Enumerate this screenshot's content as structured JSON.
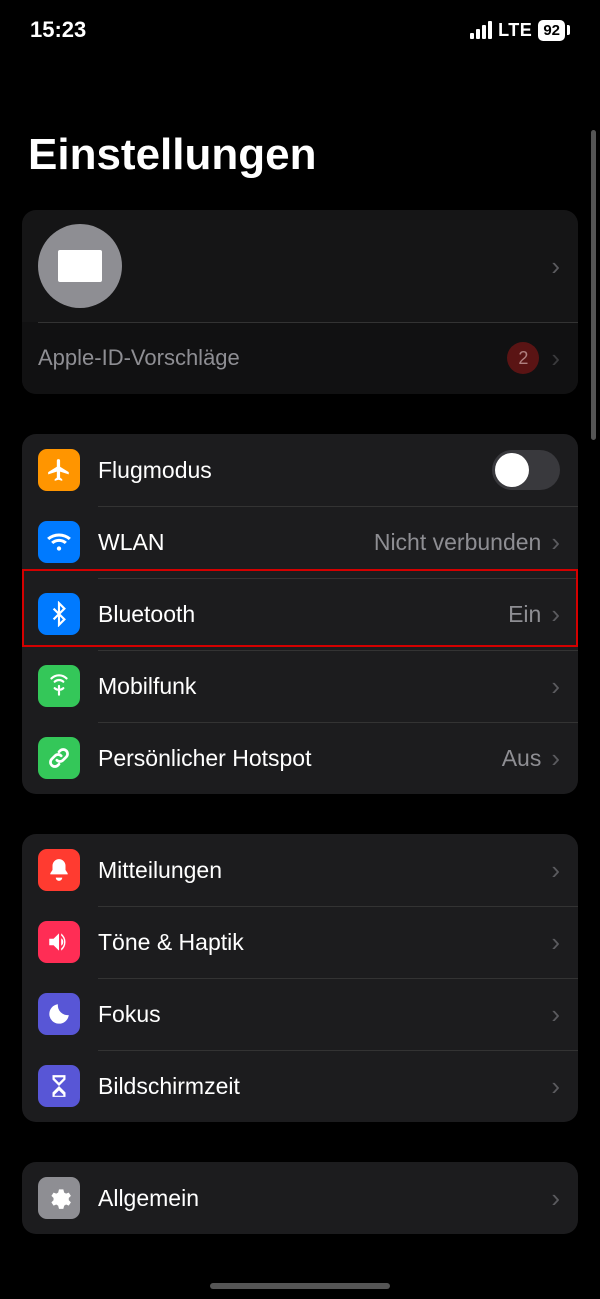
{
  "status_bar": {
    "time": "15:23",
    "network": "LTE",
    "battery": "92"
  },
  "title": "Einstellungen",
  "apple_id": {
    "suggestions_label": "Apple-ID-Vorschläge",
    "badge": "2"
  },
  "connectivity": {
    "airplane": "Flugmodus",
    "wlan": {
      "label": "WLAN",
      "value": "Nicht verbunden"
    },
    "bluetooth": {
      "label": "Bluetooth",
      "value": "Ein"
    },
    "cellular": "Mobilfunk",
    "hotspot": {
      "label": "Persönlicher Hotspot",
      "value": "Aus"
    }
  },
  "system": {
    "notifications": "Mitteilungen",
    "sounds": "Töne & Haptik",
    "focus": "Fokus",
    "screentime": "Bildschirmzeit"
  },
  "general": {
    "label": "Allgemein"
  }
}
